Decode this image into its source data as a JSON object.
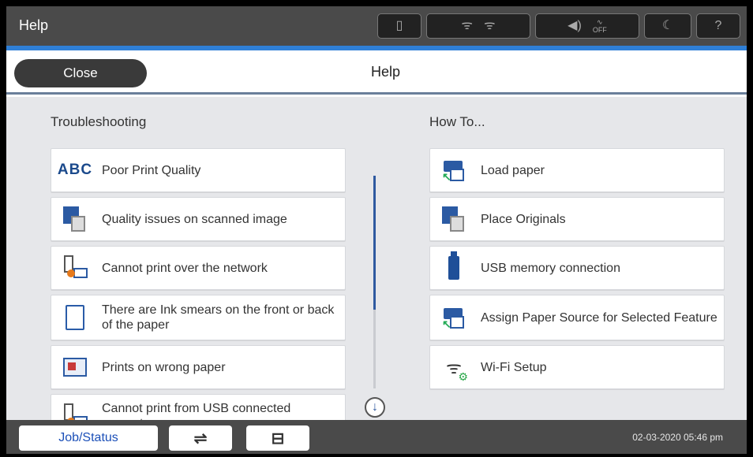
{
  "titlebar": {
    "title": "Help",
    "status_icons": [
      "printer-status-icon",
      "wifi-icon",
      "wifi-direct-icon",
      "sound-icon",
      "quiet-mode-off-icon",
      "sleep-icon",
      "help-icon"
    ],
    "quiet_off_label": "OFF"
  },
  "header": {
    "close_label": "Close",
    "title": "Help"
  },
  "troubleshooting": {
    "title": "Troubleshooting",
    "items": [
      {
        "label": "Poor Print Quality",
        "icon": "abc-print-quality-icon"
      },
      {
        "label": "Quality issues on scanned image",
        "icon": "scanned-image-icon"
      },
      {
        "label": "Cannot print over the network",
        "icon": "network-print-icon"
      },
      {
        "label": "There are Ink smears on the front or back of the paper",
        "icon": "paper-smear-icon"
      },
      {
        "label": "Prints on wrong paper",
        "icon": "wrong-paper-icon"
      },
      {
        "label": "Cannot print from USB connected computer",
        "icon": "usb-computer-icon"
      }
    ]
  },
  "howto": {
    "title": "How To...",
    "items": [
      {
        "label": "Load paper",
        "icon": "load-paper-icon"
      },
      {
        "label": "Place Originals",
        "icon": "place-originals-icon"
      },
      {
        "label": "USB memory connection",
        "icon": "usb-memory-icon"
      },
      {
        "label": "Assign Paper Source for Selected Feature",
        "icon": "paper-source-icon"
      },
      {
        "label": "Wi-Fi Setup",
        "icon": "wifi-setup-icon"
      }
    ]
  },
  "bottombar": {
    "job_status_label": "Job/Status",
    "datetime": "02-03-2020 05:46 pm"
  },
  "colors": {
    "accent": "#2f7fd6",
    "titlebar_bg": "#4a4a4a",
    "content_bg": "#e6e7ea",
    "icon_blue": "#2b5aa3"
  }
}
